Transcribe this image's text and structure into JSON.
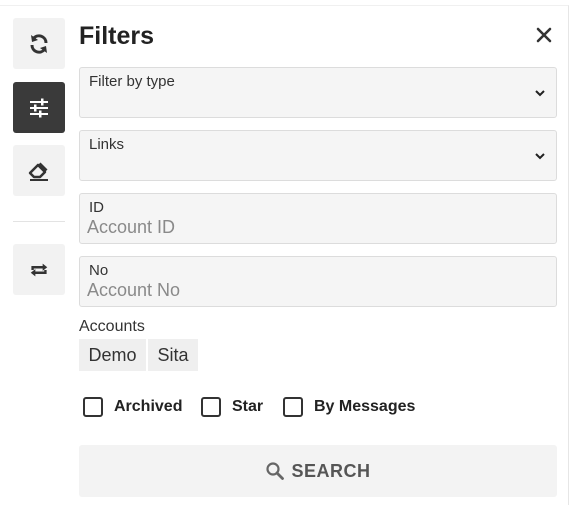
{
  "sidebar": {
    "tools": [
      {
        "icon": "refresh-icon",
        "active": false
      },
      {
        "icon": "sliders-icon",
        "active": true
      },
      {
        "icon": "eraser-icon",
        "active": false
      },
      {
        "icon": "repeat-icon",
        "active": false
      }
    ]
  },
  "panel": {
    "title": "Filters",
    "close_icon": "close-icon"
  },
  "filters": {
    "type_select": {
      "label": "Filter by type",
      "value": ""
    },
    "links_select": {
      "label": "Links",
      "value": ""
    },
    "id_field": {
      "label": "ID",
      "placeholder": "Account ID",
      "value": ""
    },
    "no_field": {
      "label": "No",
      "placeholder": "Account No",
      "value": ""
    }
  },
  "accounts": {
    "label": "Accounts",
    "chips": [
      "Demo",
      "Sita"
    ]
  },
  "options": [
    {
      "label": "Archived",
      "checked": false
    },
    {
      "label": "Star",
      "checked": false
    },
    {
      "label": "By Messages",
      "checked": false
    }
  ],
  "search": {
    "label": "SEARCH",
    "icon": "search-icon"
  },
  "colors": {
    "active_tool": "#3a3a3a",
    "field_bg": "#f5f5f5",
    "placeholder": "#8a8a8a"
  }
}
